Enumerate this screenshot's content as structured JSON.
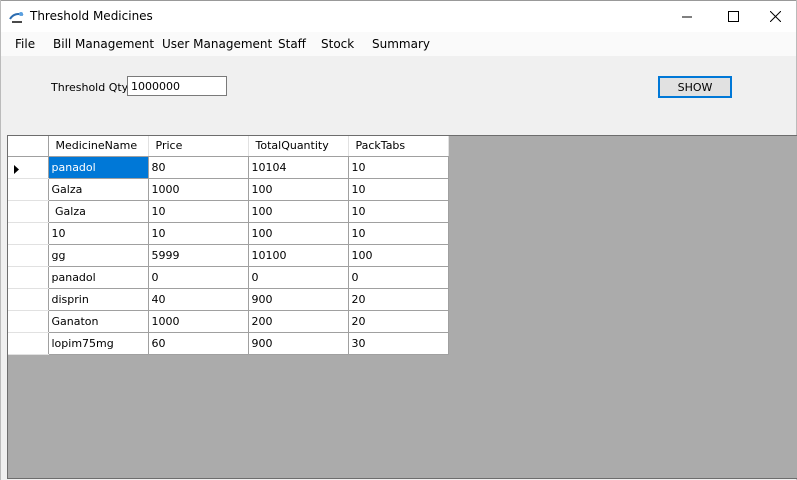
{
  "window": {
    "title": "Threshold Medicines",
    "controls": {
      "minimize": "minimize-icon",
      "maximize": "maximize-icon",
      "close": "close-icon"
    }
  },
  "menu": {
    "items": [
      {
        "label": "File"
      },
      {
        "label": "Bill Management"
      },
      {
        "label": "User Management"
      },
      {
        "label": "Staff"
      },
      {
        "label": "Stock"
      },
      {
        "label": "Summary"
      }
    ]
  },
  "form": {
    "threshold_label": "Threshold Qty",
    "threshold_value": "1000000",
    "show_button": "SHOW"
  },
  "table": {
    "columns": [
      "MedicineName",
      "Price",
      "TotalQuantity",
      "PackTabs"
    ],
    "rows": [
      [
        "panadol",
        "80",
        "10104",
        "10"
      ],
      [
        "Galza",
        "1000",
        "100",
        "10"
      ],
      [
        " Galza",
        "10",
        "100",
        "10"
      ],
      [
        "10",
        "10",
        "100",
        "10"
      ],
      [
        "gg",
        "5999",
        "10100",
        "100"
      ],
      [
        "panadol",
        "0",
        "0",
        "0"
      ],
      [
        "disprin",
        "40",
        "900",
        "20"
      ],
      [
        "Ganaton",
        "1000",
        "200",
        "20"
      ],
      [
        "lopim75mg",
        "60",
        "900",
        "30"
      ]
    ],
    "current_row_index": 0
  },
  "colors": {
    "selection": "#0078d7",
    "grid_background": "#ababab",
    "button_border": "#0078d7"
  }
}
